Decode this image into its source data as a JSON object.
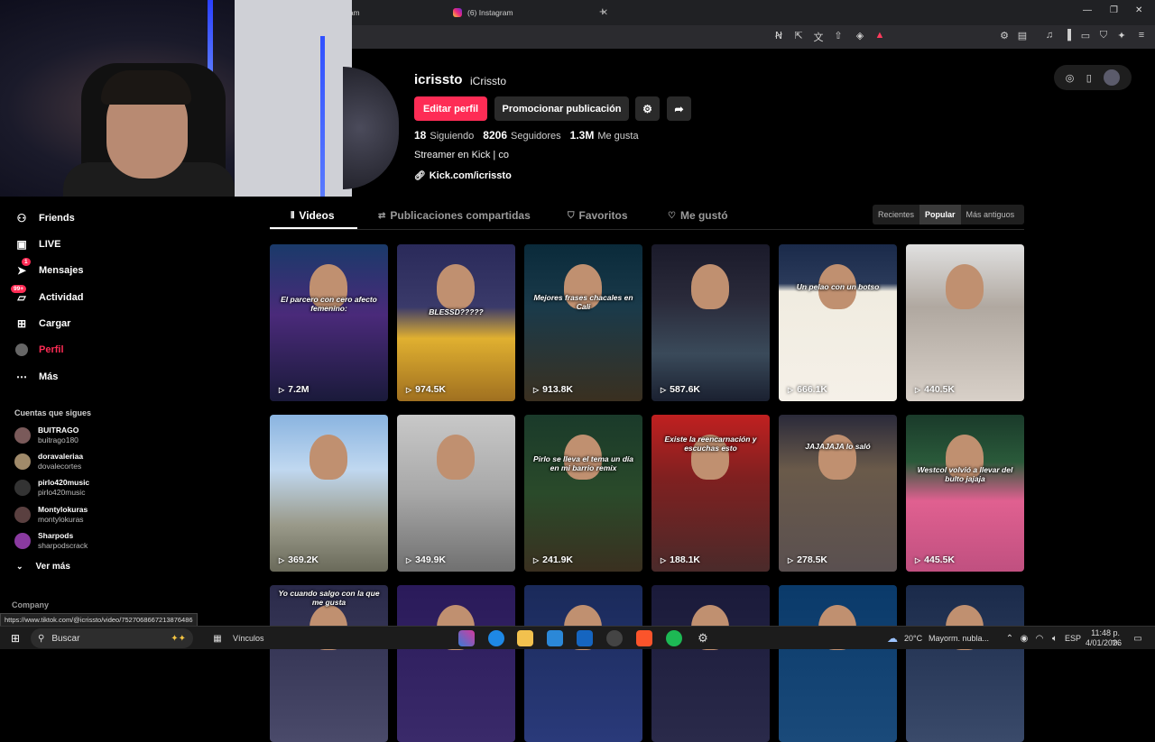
{
  "browser": {
    "tabs": [
      {
        "label": "ram"
      },
      {
        "label": "(6) Instagram"
      }
    ],
    "new_tab": "+",
    "window_controls": [
      "—",
      "❐",
      "✕"
    ]
  },
  "sidebar": {
    "items": [
      {
        "label": "Friends",
        "icon": "friends-icon",
        "glyph": "👥"
      },
      {
        "label": "LIVE",
        "icon": "live-icon",
        "glyph": "▣"
      },
      {
        "label": "Mensajes",
        "icon": "messages-icon",
        "glyph": "✈",
        "badge": "1"
      },
      {
        "label": "Actividad",
        "icon": "activity-icon",
        "glyph": "✉",
        "badge": "99+"
      },
      {
        "label": "Cargar",
        "icon": "upload-icon",
        "glyph": "⊞"
      },
      {
        "label": "Perfil",
        "icon": "profile-icon",
        "glyph": "●"
      },
      {
        "label": "Más",
        "icon": "more-icon",
        "glyph": "···"
      }
    ],
    "following_title": "Cuentas que sigues",
    "accounts": [
      {
        "name": "BUITRAGO",
        "handle": "buitrago180"
      },
      {
        "name": "doravaleriaa",
        "handle": "dovalecortes"
      },
      {
        "name": "pirlo420music",
        "handle": "pirlo420music"
      },
      {
        "name": "Montylokuras",
        "handle": "montylokuras"
      },
      {
        "name": "Sharpods",
        "handle": "sharpodscrack"
      }
    ],
    "see_more": "Ver más",
    "company": "Company"
  },
  "status_url": "https://www.tiktok.com/@icrissto/video/7527068667213876486",
  "profile": {
    "username": "icrissto",
    "nickname": "iCrissto",
    "edit_label": "Editar perfil",
    "promote_label": "Promocionar publicación",
    "following_count": "18",
    "following_label": "Siguiendo",
    "followers_count": "8206",
    "followers_label": "Seguidores",
    "likes_count": "1.3M",
    "likes_label": "Me gusta",
    "bio": "Streamer en Kick | co",
    "link": "Kick.com/icrissto"
  },
  "tabs": {
    "videos": "Videos",
    "shared": "Publicaciones compartidas",
    "favorites": "Favoritos",
    "liked": "Me gustó"
  },
  "sort": {
    "recent": "Recientes",
    "popular": "Popular",
    "oldest": "Más antiguos"
  },
  "videos": [
    {
      "views": "7.2M",
      "caption": "El parcero con cero afecto femenino:"
    },
    {
      "views": "974.5K",
      "caption": "BLESSD?????"
    },
    {
      "views": "913.8K",
      "caption": "Mejores frases chacales en Cali"
    },
    {
      "views": "587.6K",
      "caption": ""
    },
    {
      "views": "666.1K",
      "caption": "Un pelao con un botso"
    },
    {
      "views": "440.5K",
      "caption": ""
    },
    {
      "views": "369.2K",
      "caption": ""
    },
    {
      "views": "349.9K",
      "caption": ""
    },
    {
      "views": "241.9K",
      "caption": "Pirlo se lleva el tema un día en mi barrio remix"
    },
    {
      "views": "188.1K",
      "caption": "Existe la reencarnación y escuchas esto"
    },
    {
      "views": "278.5K",
      "caption": "JAJAJAJA lo saló"
    },
    {
      "views": "445.5K",
      "caption": "Westcol volvió a llevar del bulto jajaja"
    },
    {
      "views": "",
      "caption": "Yo cuando salgo con la que me gusta"
    },
    {
      "views": "",
      "caption": ""
    },
    {
      "views": "",
      "caption": ""
    },
    {
      "views": "",
      "caption": ""
    },
    {
      "views": "",
      "caption": ""
    },
    {
      "views": "",
      "caption": ""
    }
  ],
  "taskbar": {
    "search": "Buscar",
    "vinculos": "Vínculos",
    "weather_temp": "20°C",
    "weather_desc": "Mayorm. nubla...",
    "lang": "ESP",
    "time": "11:48 p. m.",
    "date": "4/01/2026"
  }
}
